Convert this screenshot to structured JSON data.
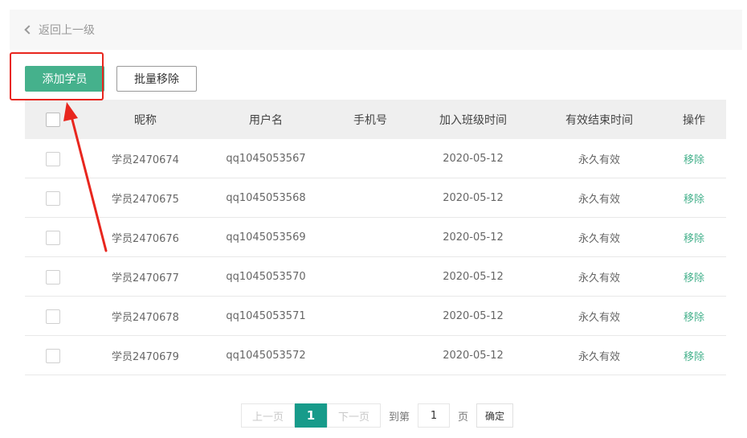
{
  "header": {
    "back_label": "返回上一级",
    "back_icon": "chevron-left-icon"
  },
  "toolbar": {
    "add_label": "添加学员",
    "batch_remove_label": "批量移除",
    "accent": "#45b18c"
  },
  "table": {
    "columns": {
      "nickname": "昵称",
      "username": "用户名",
      "phone": "手机号",
      "join_time": "加入班级时间",
      "expire_time": "有效结束时间",
      "action": "操作"
    },
    "rows": [
      {
        "nickname": "学员2470674",
        "username": "qq1045053567",
        "phone": "",
        "join_time": "2020-05-12",
        "expire_time": "永久有效",
        "action": "移除"
      },
      {
        "nickname": "学员2470675",
        "username": "qq1045053568",
        "phone": "",
        "join_time": "2020-05-12",
        "expire_time": "永久有效",
        "action": "移除"
      },
      {
        "nickname": "学员2470676",
        "username": "qq1045053569",
        "phone": "",
        "join_time": "2020-05-12",
        "expire_time": "永久有效",
        "action": "移除"
      },
      {
        "nickname": "学员2470677",
        "username": "qq1045053570",
        "phone": "",
        "join_time": "2020-05-12",
        "expire_time": "永久有效",
        "action": "移除"
      },
      {
        "nickname": "学员2470678",
        "username": "qq1045053571",
        "phone": "",
        "join_time": "2020-05-12",
        "expire_time": "永久有效",
        "action": "移除"
      },
      {
        "nickname": "学员2470679",
        "username": "qq1045053572",
        "phone": "",
        "join_time": "2020-05-12",
        "expire_time": "永久有效",
        "action": "移除"
      }
    ]
  },
  "pagination": {
    "prev_label": "上一页",
    "current_page": "1",
    "next_label": "下一页",
    "goto_label": "到第",
    "page_input_value": "1",
    "page_suffix": "页",
    "confirm_label": "确定",
    "active_color": "#179b8a"
  },
  "annotation": {
    "color": "#e8261e"
  }
}
